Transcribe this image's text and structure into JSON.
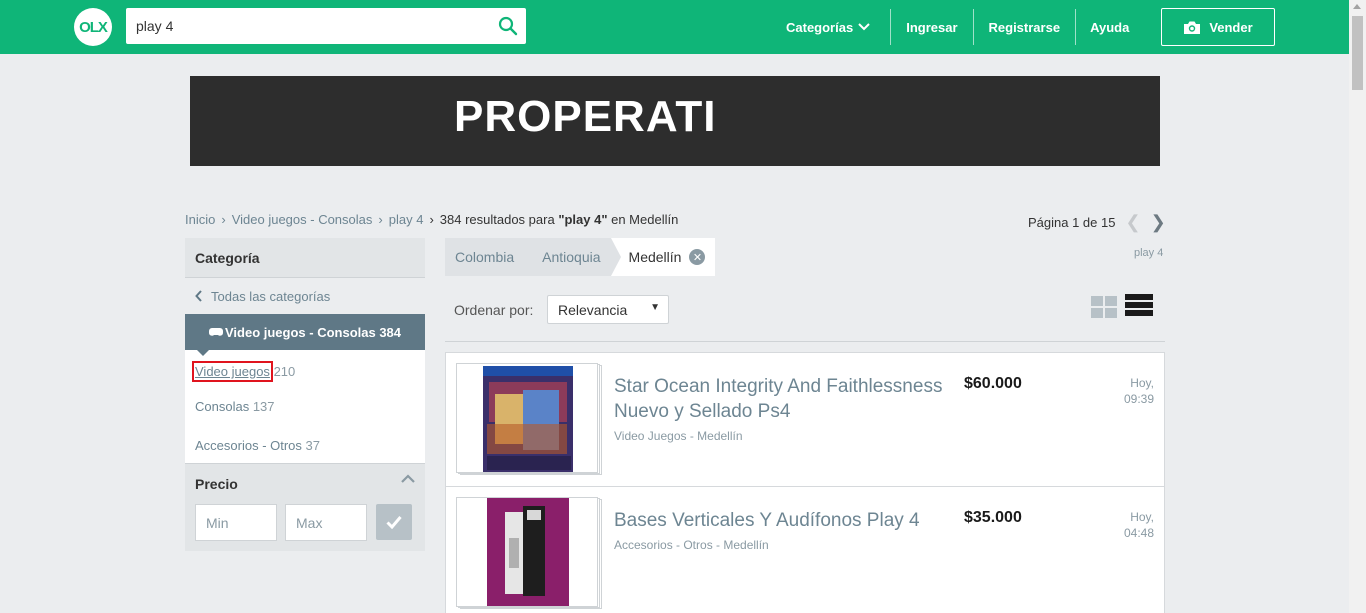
{
  "header": {
    "logo_text": "OLX",
    "search_value": "play 4",
    "nav": {
      "categorias": "Categorías",
      "ingresar": "Ingresar",
      "registrarse": "Registrarse",
      "ayuda": "Ayuda"
    },
    "vender_label": "Vender",
    "brand_color": "#0fb578"
  },
  "banner": {
    "text": "PROPERATI"
  },
  "breadcrumb": {
    "items": [
      "Inicio",
      "Video juegos - Consolas",
      "play 4"
    ],
    "results_prefix": "384 resultados para ",
    "results_query": "\"play 4\"",
    "results_suffix": " en Medellín"
  },
  "pager": {
    "label": "Página 1 de 15"
  },
  "sidebar": {
    "heading": "Categoría",
    "back_label": "Todas las categorías",
    "active": {
      "label": "Video juegos - Consolas",
      "count": "384"
    },
    "items": [
      {
        "label": "Video juegos",
        "count": "210"
      },
      {
        "label": "Consolas",
        "count": "137"
      },
      {
        "label": "Accesorios - Otros",
        "count": "37"
      }
    ],
    "price": {
      "title": "Precio",
      "min_placeholder": "Min",
      "max_placeholder": "Max"
    }
  },
  "location": {
    "chips": [
      "Colombia",
      "Antioquia",
      "Medellín"
    ],
    "tag": "play 4"
  },
  "sort": {
    "label": "Ordenar por:",
    "selected": "Relevancia"
  },
  "listings": [
    {
      "title": "Star Ocean Integrity And Faithlessness Nuevo y Sellado Ps4",
      "subtitle": "Video Juegos - Medellín",
      "price": "$60.000",
      "date_day": "Hoy,",
      "date_time": "09:39"
    },
    {
      "title": "Bases Verticales Y Audífonos Play 4",
      "subtitle": "Accesorios - Otros - Medellín",
      "price": "$35.000",
      "date_day": "Hoy,",
      "date_time": "04:48"
    }
  ]
}
